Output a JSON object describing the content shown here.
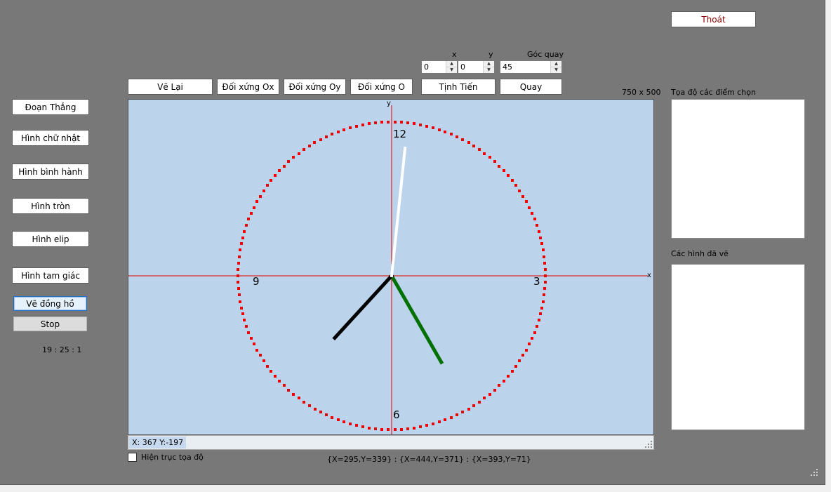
{
  "toolbar": {
    "exit": "Thoát",
    "redraw": "Vẽ Lại",
    "mirror_ox": "Đối xứng Ox",
    "mirror_oy": "Đối xứng Oy",
    "mirror_o": "Đối xứng O",
    "translate": "Tịnh Tiến",
    "rotate": "Quay"
  },
  "inputs": {
    "x_label": "x",
    "y_label": "y",
    "angle_label": "Góc quay",
    "x_value": "0",
    "y_value": "0",
    "angle_value": "45"
  },
  "shapes": {
    "line": "Đoạn Thẳng",
    "rectangle": "Hình chữ nhật",
    "parallelogram": "Hình bình hành",
    "circle": "Hình tròn",
    "ellipse": "Hình elip",
    "triangle": "Hình tam giác",
    "draw_clock": "Vẽ đồng hồ",
    "stop": "Stop",
    "time": "19 : 25 : 1"
  },
  "canvas": {
    "size_label": "750 x 500",
    "axis_x": "x",
    "axis_y": "y",
    "clock_12": "12",
    "clock_3": "3",
    "clock_6": "6",
    "clock_9": "9",
    "status": "X: 367 Y:-197",
    "clock_time": {
      "hour": 19,
      "minute": 25,
      "second": 1
    },
    "colors": {
      "background": "#bcd3ec",
      "axes": "#e00000",
      "dial": "#ee0000",
      "hour_hand": "#000000",
      "minute_hand": "#007000",
      "second_hand": "#ffffff"
    }
  },
  "bottom": {
    "show_axes": "Hiện trục tọa độ",
    "show_axes_checked": false,
    "points_text": "{X=295,Y=339} : {X=444,Y=371} : {X=393,Y=71}"
  },
  "right": {
    "selected_points_label": "Tọa độ các điểm chọn",
    "drawn_shapes_label": "Các hình đã vẽ"
  }
}
